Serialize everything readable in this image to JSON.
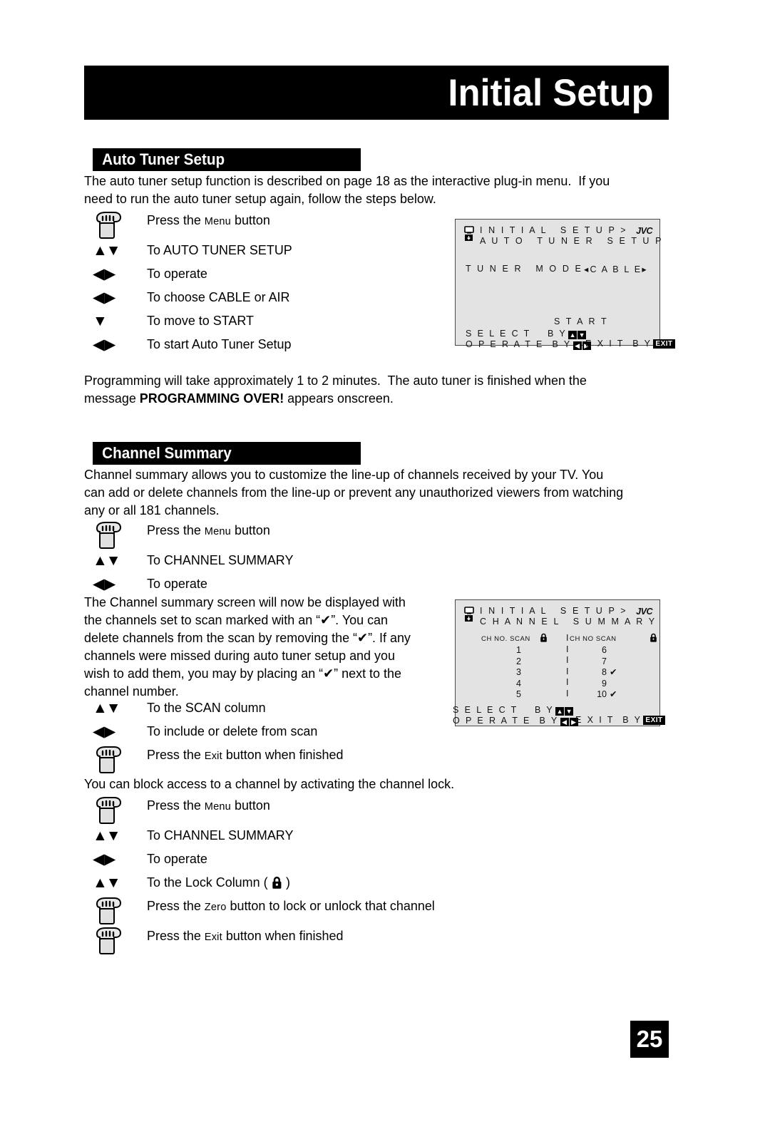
{
  "header": {
    "title": "Initial Setup"
  },
  "page_number": "25",
  "sections": {
    "auto_tuner": {
      "heading": "Auto Tuner Setup",
      "intro": "The auto tuner setup function is described on page 18 as the interactive plug-in menu.  If you\nneed to run the auto tuner setup again, follow the steps below.",
      "steps": [
        {
          "icon": "hand-icon",
          "text_pre": "Press the ",
          "smallcaps": "Menu",
          "text_post": " button"
        },
        {
          "icon": "up-down-arrows",
          "text": "To AUTO TUNER SETUP"
        },
        {
          "icon": "left-right-arrows",
          "text": "To operate"
        },
        {
          "icon": "left-right-arrows",
          "text": "To choose CABLE or AIR"
        },
        {
          "icon": "down-arrow",
          "text": "To move to START"
        },
        {
          "icon": "left-right-arrows",
          "text": "To start Auto Tuner Setup"
        }
      ],
      "note_pre": "Programming will take approximately 1 to 2 minutes.  The auto tuner is finished when the\nmessage ",
      "note_bold": "PROGRAMMING OVER!",
      "note_post": " appears onscreen."
    },
    "channel_summary": {
      "heading": "Channel Summary",
      "intro": "Channel summary allows you to customize the line-up of channels received by your TV. You\ncan add or delete channels from the line-up or prevent any unauthorized viewers from watching\nany or all 181 channels.",
      "steps_menu": [
        {
          "icon": "hand-icon",
          "text_pre": "Press the ",
          "smallcaps": "Menu",
          "text_post": " button"
        },
        {
          "icon": "up-down-arrows",
          "text": "To CHANNEL SUMMARY"
        },
        {
          "icon": "left-right-arrows",
          "text": "To operate"
        }
      ],
      "screen_paragraph": "The Channel summary screen will now be displayed with\nthe channels set to scan marked with an “✔”. You can\ndelete channels from the scan by removing the “✔”. If any\nchannels were missed during auto tuner setup and you\nwish to add them, you may by placing an “✔” next to the\nchannel number.",
      "steps_scan": [
        {
          "icon": "up-down-arrows",
          "text": "To the SCAN column"
        },
        {
          "icon": "left-right-arrows",
          "text": "To include or delete from scan"
        },
        {
          "icon": "hand-icon",
          "text_pre": "Press the ",
          "smallcaps": "Exit",
          "text_post": " button when finished"
        }
      ],
      "lock_paragraph": "You can block access to a channel by activating the channel lock.",
      "steps_lock": [
        {
          "icon": "hand-icon",
          "text_pre": "Press the ",
          "smallcaps": "Menu",
          "text_post": " button"
        },
        {
          "icon": "up-down-arrows",
          "text": "To CHANNEL SUMMARY"
        },
        {
          "icon": "left-right-arrows",
          "text": "To operate"
        },
        {
          "icon": "up-down-arrows",
          "text_pre": "To the Lock Column ( ",
          "inline_icon": "lock-icon",
          "text_post": " )"
        },
        {
          "icon": "hand-icon",
          "text_pre": "Press the ",
          "smallcaps": "Zero",
          "text_post": " button to lock or unlock that channel"
        },
        {
          "icon": "hand-icon",
          "text_pre": "Press the ",
          "smallcaps": "Exit",
          "text_post": " button when finished"
        }
      ]
    }
  },
  "osd_auto_tuner": {
    "brand": "JVC",
    "title": "I N I T I A L   S E T U P >\nA U T O   T U N E R   S E T U P",
    "tuner_mode_label": "T U N E R   M O D E",
    "tuner_mode_value": "◂C A B L E▸",
    "start_label": "S T A R T",
    "select_label": "S E L E C T    B Y",
    "operate_label": "O P E R A T E  B Y",
    "exit_label": "E X I T  B Y",
    "exit_badge": "EXIT"
  },
  "osd_channel_summary": {
    "brand": "JVC",
    "title": "I N I T I A L   S E T U P >\nC H A N N E L   S U M M A R Y",
    "head_left": "CH NO. SCAN",
    "head_right": "CH NO SCAN",
    "column_left": [
      "1",
      "2",
      "3",
      "4",
      "5"
    ],
    "column_right": [
      "6",
      "7",
      "8",
      "9",
      "10"
    ],
    "column_right_checks": [
      "",
      "",
      "✔",
      "",
      "✔"
    ],
    "select_label": "S E L E C T    B Y",
    "operate_label": "O P E R A T E  B Y",
    "exit_label": "E X I T  B Y",
    "exit_badge": "EXIT"
  },
  "colors": {
    "ink": "#000000",
    "osd_background": "#e3e3e3",
    "osd_border": "#4a4a4a",
    "paper": "#ffffff"
  }
}
